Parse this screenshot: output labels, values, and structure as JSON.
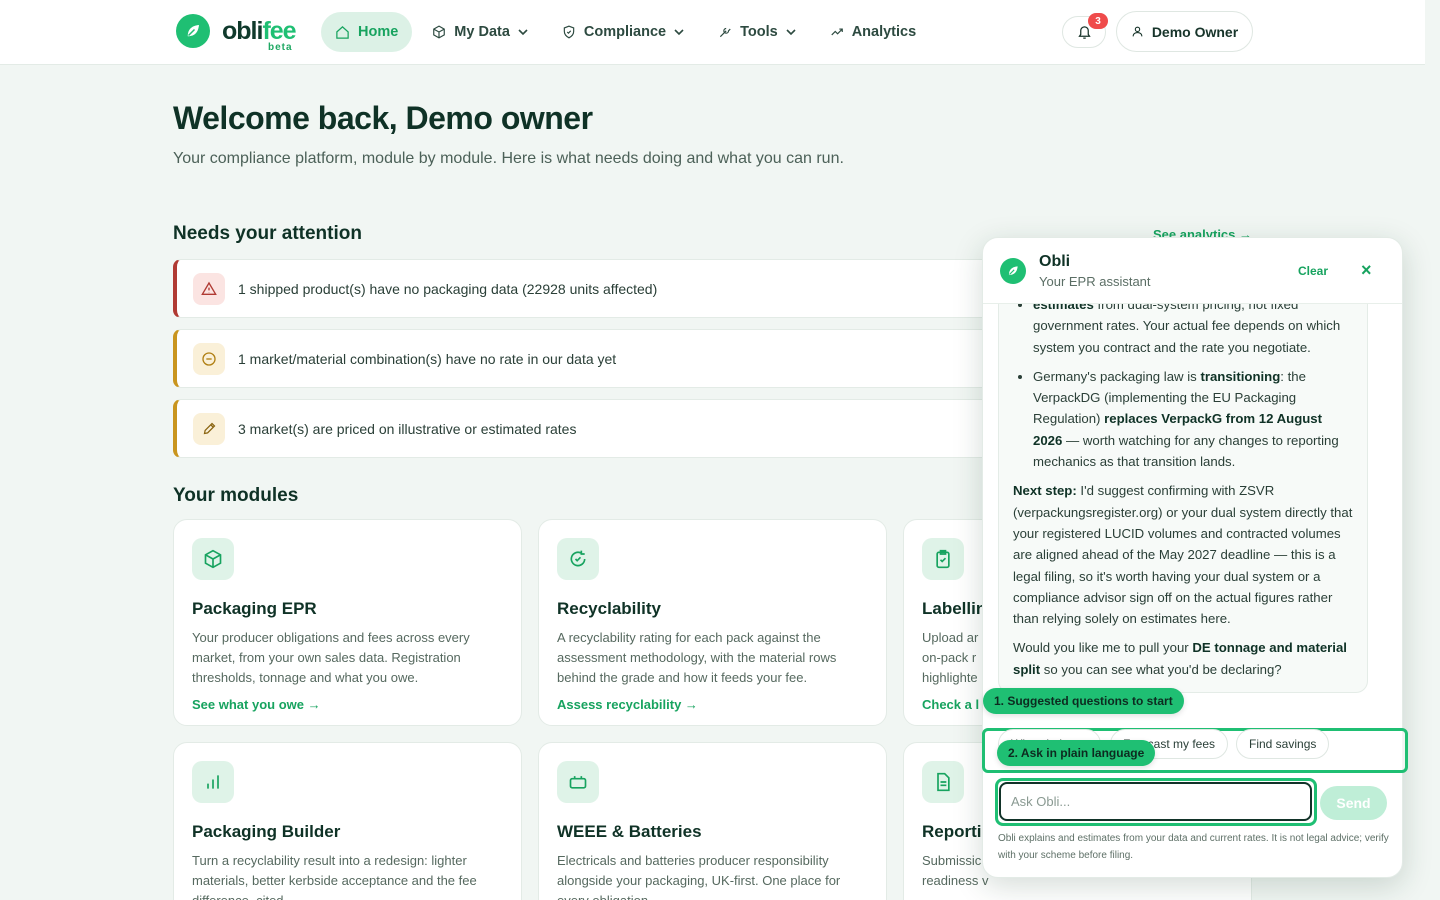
{
  "brand": {
    "name_part1": "obli",
    "name_part2": "fee",
    "tag": "beta"
  },
  "nav": {
    "items": [
      {
        "label": "Home",
        "icon": "home-icon",
        "active": true,
        "dropdown": false
      },
      {
        "label": "My Data",
        "icon": "cube-icon",
        "active": false,
        "dropdown": true
      },
      {
        "label": "Compliance",
        "icon": "shield-icon",
        "active": false,
        "dropdown": true
      },
      {
        "label": "Tools",
        "icon": "wrench-icon",
        "active": false,
        "dropdown": true
      },
      {
        "label": "Analytics",
        "icon": "trend-icon",
        "active": false,
        "dropdown": false
      }
    ],
    "notifications_count": "3",
    "user_label": "Demo Owner"
  },
  "hero": {
    "title": "Welcome back, Demo owner",
    "subtitle": "Your compliance platform, module by module. Here is what needs doing and what you can run."
  },
  "attention": {
    "title": "Needs your attention",
    "link": "See analytics →",
    "alerts": [
      {
        "text": "1 shipped product(s) have no packaging data (22928 units affected)",
        "severity": "red",
        "icon": "warning-icon"
      },
      {
        "text": "1 market/material combination(s) have no rate in our data yet",
        "severity": "amber",
        "icon": "minus-circle-icon"
      },
      {
        "text": "3 market(s) are priced on illustrative or estimated rates",
        "severity": "amber",
        "icon": "pencil-icon"
      }
    ]
  },
  "modules": {
    "title": "Your modules",
    "items": [
      {
        "title": "Packaging EPR",
        "desc": "Your producer obligations and fees across every market, from your own sales data. Registration thresholds, tonnage and what you owe.",
        "link": "See what you owe →",
        "icon": "box-icon"
      },
      {
        "title": "Recyclability",
        "desc": "A recyclability rating for each pack against the assessment methodology, with the material rows behind the grade and how it feeds your fee.",
        "link": "Assess recyclability →",
        "icon": "recycle-icon"
      },
      {
        "title": "Labellin",
        "desc": "Upload ar on-pack r highlighte",
        "link": "Check a l",
        "icon": "clipboard-icon"
      },
      {
        "title": "Packaging Builder",
        "desc": "Turn a recyclability result into a redesign: lighter materials, better kerbside acceptance and the fee difference, cited.",
        "link": "",
        "icon": "bar-chart-icon"
      },
      {
        "title": "WEEE & Batteries",
        "desc": "Electricals and batteries producer responsibility alongside your packaging, UK-first. One place for every obligation.",
        "link": "",
        "icon": "battery-icon"
      },
      {
        "title": "Reporti",
        "desc": "Submissic readiness v",
        "link": "",
        "icon": "document-icon"
      }
    ]
  },
  "chat": {
    "name": "Obli",
    "role": "Your EPR assistant",
    "clear_label": "Clear",
    "close_label": "×",
    "message": {
      "b1_bold": "estimates",
      "b1_rest": " from dual-system pricing, not fixed government rates. Your actual fee depends on which system you contract and the rate you negotiate.",
      "b2_pre": "Germany's packaging law is ",
      "b2_bold1": "transitioning",
      "b2_mid": ": the VerpackDG (implementing the EU Packaging Regulation) ",
      "b2_bold2": "replaces VerpackG from 12 August 2026",
      "b2_post": " — worth watching for any changes to reporting mechanics as that transition lands.",
      "next_bold": "Next step:",
      "next_text": " I'd suggest confirming with ZSVR (verpackungsregister.org) or your dual system directly that your registered LUCID volumes and contracted volumes are aligned ahead of the May 2027 deadline — this is a legal filing, so it's worth having your dual system or a compliance advisor sign off on the actual figures rather than relying solely on estimates here.",
      "q_pre": "Would you like me to pull your ",
      "q_bold": "DE tonnage and material split",
      "q_post": " so you can see what you'd be declaring?"
    },
    "tip1": "1. Suggested questions to start",
    "tip2": "2. Ask in plain language",
    "chips": [
      "What do I owe",
      "Forecast my fees",
      "Find savings"
    ],
    "input_placeholder": "Ask Obli...",
    "send_label": "Send",
    "disclaimer": "Obli explains and estimates from your data and current rates. It is not legal advice; verify with your scheme before filing."
  },
  "colors": {
    "accent": "#1fbf73",
    "accent_dark": "#17a35f",
    "alert_red": "#b03a33",
    "alert_amber": "#c9951e"
  }
}
